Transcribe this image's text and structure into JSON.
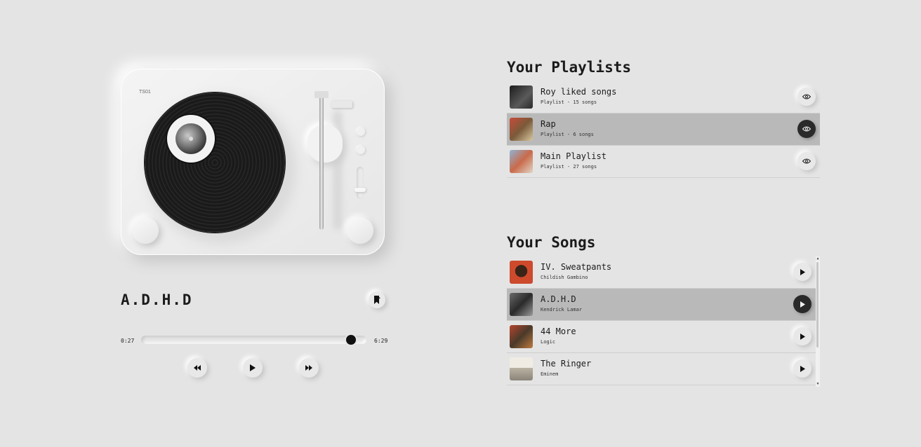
{
  "turntable": {
    "model_label": "TS01"
  },
  "now_playing": {
    "title": "A.D.H.D",
    "elapsed": "0:27",
    "duration": "6:29",
    "progress": 0.93
  },
  "icons": {
    "bookmark": "bookmark-icon",
    "previous": "rewind-icon",
    "play": "play-icon",
    "next": "fast-forward-icon",
    "view": "eye-icon"
  },
  "colors": {
    "background": "#e4e4e4",
    "active_row": "#b9b9b9",
    "accent": "#111111"
  },
  "playlists": {
    "heading": "Your Playlists",
    "items": [
      {
        "name": "Roy liked songs",
        "meta": "Playlist - 15 songs",
        "active": false
      },
      {
        "name": "Rap",
        "meta": "Playlist - 6 songs",
        "active": true
      },
      {
        "name": "Main Playlist",
        "meta": "Playlist - 27 songs",
        "active": false
      }
    ]
  },
  "songs": {
    "heading": "Your Songs",
    "items": [
      {
        "title": "IV. Sweatpants",
        "artist": "Childish Gambino",
        "active": false
      },
      {
        "title": "A.D.H.D",
        "artist": "Kendrick Lamar",
        "active": true
      },
      {
        "title": "44 More",
        "artist": "Logic",
        "active": false
      },
      {
        "title": "The Ringer",
        "artist": "Eminem",
        "active": false
      }
    ]
  }
}
